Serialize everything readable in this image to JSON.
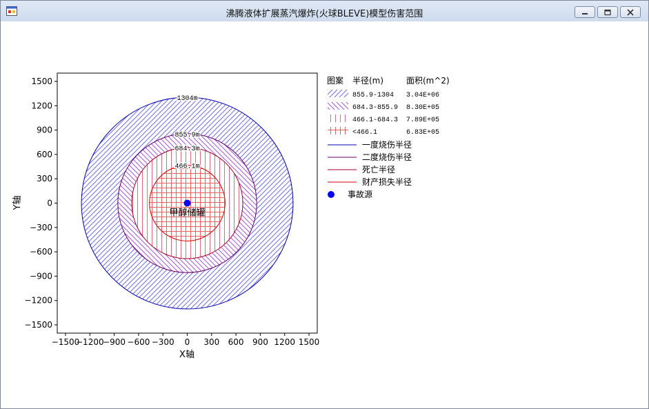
{
  "window": {
    "title": "沸腾液体扩展蒸汽爆炸(火球BLEVE)模型伤害范围",
    "icon": "app-window-icon",
    "controls": [
      "minimize-icon",
      "maximize-icon",
      "close-icon"
    ]
  },
  "chart_data": {
    "type": "area",
    "xlabel": "X轴",
    "ylabel": "Y轴",
    "xlim": [
      -1500,
      1500
    ],
    "ylim": [
      -1500,
      1500
    ],
    "xticks": [
      -1500,
      -1200,
      -900,
      -600,
      -300,
      0,
      300,
      600,
      900,
      1200,
      1500
    ],
    "yticks": [
      1500,
      1200,
      900,
      600,
      300,
      0,
      -300,
      -600,
      -900,
      -1200,
      -1500
    ],
    "tick_labels": [
      "−1500",
      "−1200",
      "−900",
      "−600",
      "−300",
      "0",
      "300",
      "600",
      "900",
      "1200",
      "1500"
    ],
    "circles": [
      {
        "radius": 1304,
        "label": "1304m",
        "color": "#0000aa",
        "hatch": "diag-blue"
      },
      {
        "radius": 855.9,
        "label": "855.9m",
        "color": "#660066",
        "hatch": "diag-purple"
      },
      {
        "radius": 684.3,
        "label": "684.3m",
        "color": "#a0002a",
        "hatch": "vert-red"
      },
      {
        "radius": 466.1,
        "label": "466.1m",
        "color": "#d40000",
        "hatch": "grid-red"
      }
    ],
    "source": {
      "x": 0,
      "y": 0,
      "label": "甲醇储罐",
      "color": "#0000ff"
    },
    "legend": {
      "placement": "right",
      "headers": [
        "图案",
        "半径(m)",
        "面积(m^2)"
      ],
      "rows": [
        {
          "range": "855.9-1304",
          "area": "3.04E+06",
          "hatch": "diag-blue"
        },
        {
          "range": "684.3-855.9",
          "area": "8.30E+05",
          "hatch": "diag-purple"
        },
        {
          "range": "466.1-684.3",
          "area": "7.89E+05",
          "hatch": "vert-red"
        },
        {
          "range": "<466.1",
          "area": "6.83E+05",
          "hatch": "grid-red"
        }
      ],
      "lines": [
        {
          "label": "一度烧伤半径",
          "color": "#0000aa"
        },
        {
          "label": "二度烧伤半径",
          "color": "#660066"
        },
        {
          "label": "死亡半径",
          "color": "#a0002a"
        },
        {
          "label": "财产损失半径",
          "color": "#d40000"
        }
      ],
      "marker": {
        "label": "事故源",
        "color": "#0000ff"
      }
    }
  }
}
